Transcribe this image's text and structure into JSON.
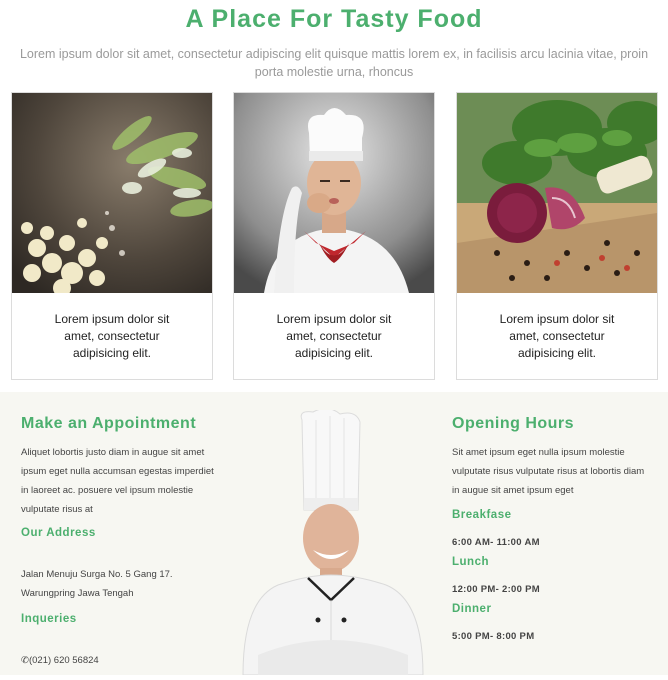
{
  "hero": {
    "title": "A Place For Tasty Food",
    "subtitle": "Lorem ipsum dolor sit amet, consectetur adipiscing elit quisque mattis lorem ex, in facilisis arcu lacinia vitae, proin porta molestie urna, rhoncus"
  },
  "cards": [
    {
      "image": "sliced-onions-garlic-image",
      "text": "Lorem ipsum dolor sit amet, consectetur adipisicing elit."
    },
    {
      "image": "chef-kiss-image",
      "text": "Lorem ipsum dolor sit amet, consectetur adipisicing elit."
    },
    {
      "image": "red-onion-peppercorn-image",
      "text": "Lorem ipsum dolor sit amet, consectetur adipisicing elit."
    }
  ],
  "appointment": {
    "title": "Make an Appointment",
    "text": "Aliquet lobortis justo diam in augue sit amet ipsum eget nulla accumsan egestas imperdiet in laoreet ac. posuere vel ipsum molestie vulputate risus at",
    "address_title": "Our Address",
    "address": "Jalan Menuju Surga No. 5 Gang 17. Warungpring Jawa Tengah",
    "inquiries_title": "Inqueries",
    "phone": "(021) 620 56824",
    "phone_icon": "phone-icon"
  },
  "hours": {
    "title": "Opening Hours",
    "text": "Sit amet ipsum eget nulla ipsum molestie vulputate risus vulputate risus at lobortis diam in augue sit amet ipsum eget",
    "items": [
      {
        "label": "Breakfase",
        "time": "6:00 AM- 11:00 AM"
      },
      {
        "label": "Lunch",
        "time": "12:00 PM- 2:00 PM"
      },
      {
        "label": "Dinner",
        "time": "5:00 PM- 8:00 PM"
      }
    ]
  },
  "colors": {
    "accent": "#4caf6e",
    "muted_text": "#9a9a9a",
    "section_bg": "#f7f7f2"
  }
}
